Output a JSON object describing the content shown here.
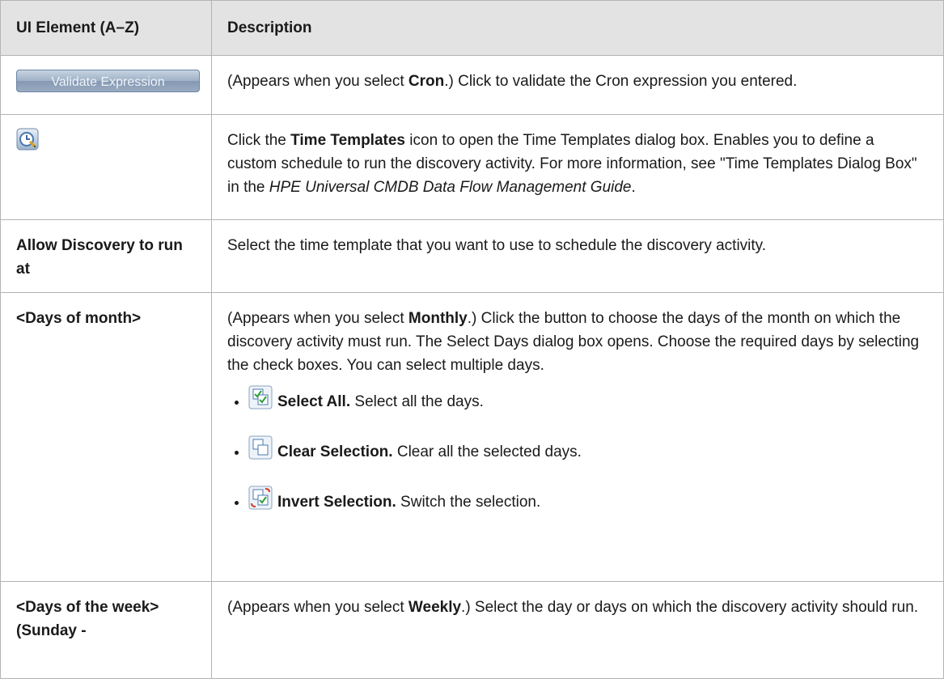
{
  "table": {
    "header": {
      "col1": "UI Element (A–Z)",
      "col2": "Description"
    },
    "rows": {
      "validate": {
        "button_label": "Validate Expression",
        "desc_pre": "(Appears when you select ",
        "desc_bold": "Cron",
        "desc_post": ".) Click to validate the Cron expression you entered."
      },
      "time_templates": {
        "icon": "time-templates-icon",
        "desc_pre": "Click the ",
        "desc_bold": "Time Templates",
        "desc_mid": " icon to open the Time Templates dialog box. Enables you to define a custom schedule to run the discovery activity. For more information, see \"Time Templates Dialog Box\" in the ",
        "desc_italic": "HPE Universal CMDB Data Flow Management Guide",
        "desc_post": "."
      },
      "allow_discovery": {
        "element": "Allow Discovery to run at",
        "desc": "Select the time template that you want to use to schedule the discovery activity."
      },
      "days_of_month": {
        "element": "<Days of month>",
        "desc_pre": "(Appears when you select ",
        "desc_bold": "Monthly",
        "desc_post": ".) Click the button to choose the days of the month on which the discovery activity must run. The Select Days dialog box opens. Choose the required days by selecting the check boxes. You can select multiple days.",
        "options": [
          {
            "icon": "select-all-icon",
            "label": "Select All.",
            "text": " Select all the days."
          },
          {
            "icon": "clear-selection-icon",
            "label": "Clear Selection.",
            "text": " Clear all the selected days."
          },
          {
            "icon": "invert-selection-icon",
            "label": "Invert Selection.",
            "text": " Switch the selection."
          }
        ]
      },
      "days_of_week": {
        "element": "<Days of the week> (Sunday -",
        "desc_pre": "(Appears when you select ",
        "desc_bold": "Weekly",
        "desc_post": ".) Select the day or days on which the discovery activity should run."
      }
    }
  }
}
